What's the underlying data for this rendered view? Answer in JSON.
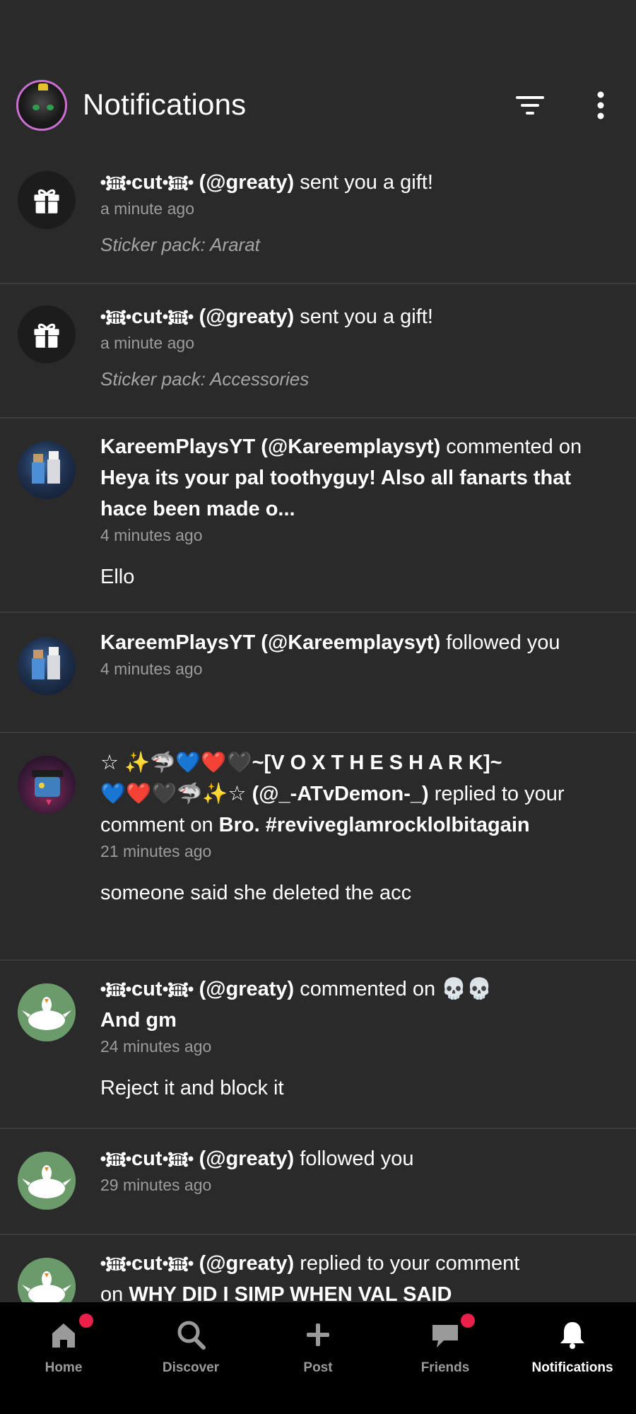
{
  "header": {
    "title": "Notifications",
    "avatar_icon": "profile-avatar"
  },
  "notifications": [
    {
      "type": "gift",
      "name": "cut",
      "handle": "(@greaty)",
      "text": "sent you a gift!",
      "time": "a minute ago",
      "extra": "Sticker pack: Ararat"
    },
    {
      "type": "gift",
      "name": "cut",
      "handle": "(@greaty)",
      "text": "sent you a gift!",
      "time": "a minute ago",
      "extra": "Sticker pack: Accessories"
    },
    {
      "type": "comment",
      "name": "KareemPlaysYT (@Kareemplaysyt)",
      "text": "commented on",
      "post": "Heya its your pal toothyguy! Also all fanarts that hace been made o...",
      "time": "4 minutes ago",
      "comment": "Ello"
    },
    {
      "type": "follow",
      "name": "KareemPlaysYT (@Kareemplaysyt)",
      "text": "followed you",
      "time": "4 minutes ago"
    },
    {
      "type": "reply",
      "name_line1": "☆ ✨🦈💙❤️🖤~[V O X T H E S H A R K]~",
      "name_line2": "💙❤️🖤🦈✨☆ (@_-ATvDemon-_)",
      "text": "replied to your comment on",
      "post": "Bro. #reviveglamrocklolbitagain",
      "time": "21 minutes ago",
      "comment": "someone said she deleted the acc"
    },
    {
      "type": "comment",
      "name": "cut",
      "handle": "(@greaty)",
      "text": "commented on",
      "post_emoji": "💀💀",
      "post": "And gm",
      "time": "24 minutes ago",
      "comment": "Reject it and block it"
    },
    {
      "type": "follow",
      "name": "cut",
      "handle": "(@greaty)",
      "text": "followed you",
      "time": "29 minutes ago"
    },
    {
      "type": "reply",
      "name": "cut",
      "handle": "(@greaty)",
      "text": "replied to your comment",
      "text2": "on",
      "post": "WHY DID I SIMP WHEN VAL SAID"
    }
  ],
  "tabs": [
    {
      "label": "Home",
      "icon": "home-icon",
      "badge": true
    },
    {
      "label": "Discover",
      "icon": "search-icon",
      "badge": false
    },
    {
      "label": "Post",
      "icon": "plus-icon",
      "badge": false
    },
    {
      "label": "Friends",
      "icon": "chat-icon",
      "badge": true
    },
    {
      "label": "Notifications",
      "icon": "bell-icon",
      "badge": false,
      "active": true
    }
  ],
  "colors": {
    "background": "#2a2a2b",
    "tabbar": "#000000",
    "badge": "#e8204a",
    "muted_text": "#9c9c9c"
  }
}
